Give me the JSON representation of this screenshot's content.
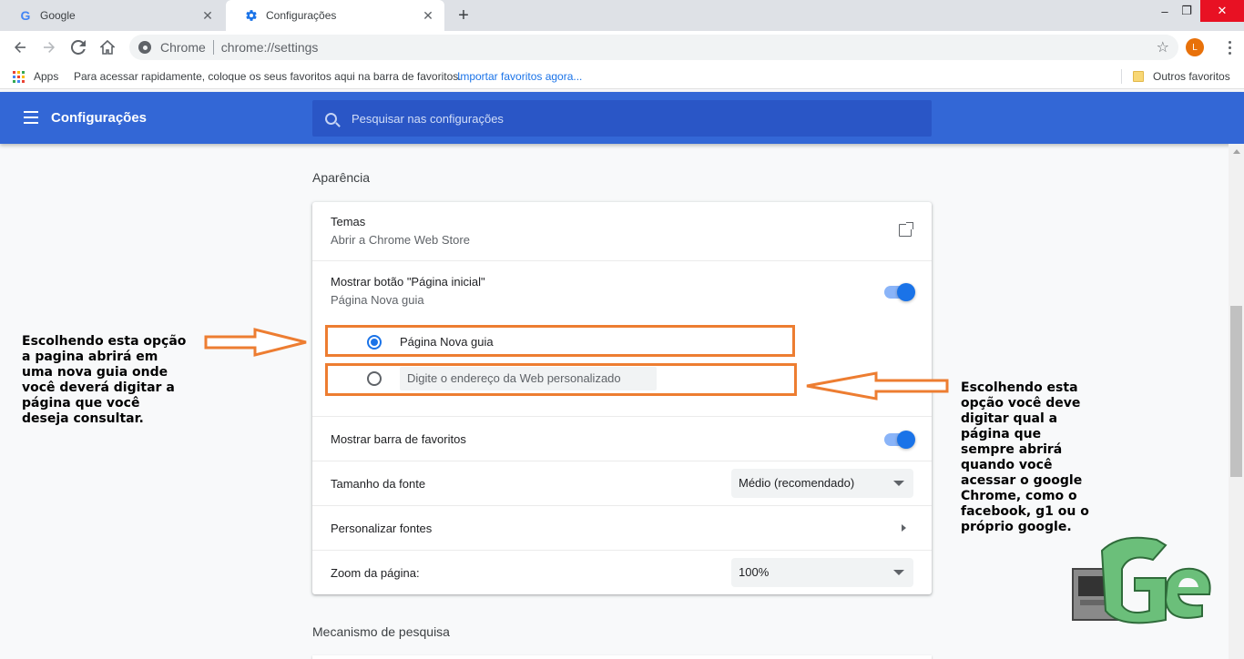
{
  "browser": {
    "tabs": [
      {
        "title": "Google",
        "favicon": "google-icon",
        "active": false
      },
      {
        "title": "Configurações",
        "favicon": "gear-icon",
        "active": true
      }
    ],
    "omnibox": {
      "chip": "Chrome",
      "url": "chrome://settings"
    },
    "avatar_letter": "L",
    "bookmarks": {
      "apps": "Apps",
      "hint": "Para acessar rapidamente, coloque os seus favoritos aqui na barra de favoritos.",
      "import": "Importar favoritos agora...",
      "others": "Outros favoritos"
    }
  },
  "settings": {
    "header_title": "Configurações",
    "search_placeholder": "Pesquisar nas configurações",
    "appearance": {
      "section_title": "Aparência",
      "themes_label": "Temas",
      "themes_sub": "Abrir a Chrome Web Store",
      "home_label": "Mostrar botão \"Página inicial\"",
      "home_sub": "Página Nova guia",
      "radio_new_tab": "Página Nova guia",
      "radio_custom": "Digite o endereço da Web personalizado",
      "bookmarks_bar_label": "Mostrar barra de favoritos",
      "font_size_label": "Tamanho da fonte",
      "font_size_value": "Médio (recomendado)",
      "custom_fonts_label": "Personalizar fontes",
      "zoom_label": "Zoom da página:",
      "zoom_value": "100%"
    },
    "search_engine_title": "Mecanismo de pesquisa"
  },
  "annotations": {
    "left": [
      "Escolhendo esta opção",
      "a pagina abrirá em",
      "uma nova guia onde",
      "você deverá digitar a",
      "página que você",
      "deseja consultar."
    ],
    "right": [
      "Escolhendo esta",
      "opção você deve",
      "digitar qual a",
      "página que",
      "sempre abrirá",
      "quando você",
      "acessar o google",
      "Chrome, como o",
      "facebook, g1 ou o",
      "próprio google."
    ]
  },
  "colors": {
    "header_blue": "#3367d6",
    "accent_blue": "#1a73e8",
    "annotation_orange": "#ed7d31"
  }
}
